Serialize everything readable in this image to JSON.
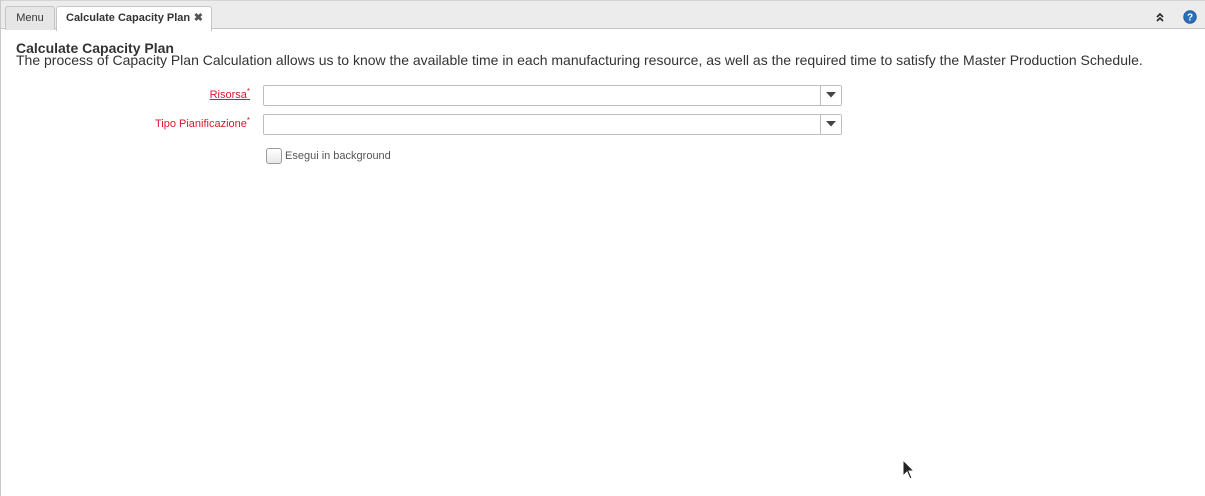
{
  "tabs": [
    {
      "label": "Menu",
      "active": false
    },
    {
      "label": "Calculate Capacity Plan",
      "active": true,
      "closable": true
    }
  ],
  "tabbar_icons": {
    "collapse": "double-chevron-up-icon",
    "help": "help-circle-icon"
  },
  "process": {
    "title": "Calculate Capacity Plan",
    "description": "The process of Capacity Plan Calculation allows us to know the available time in each manufacturing resource, as well as the required time to satisfy the Master Production Schedule."
  },
  "fields": {
    "risorsa": {
      "label": "Risorsa",
      "required_mark": "*",
      "value": ""
    },
    "tipo_pianificazione": {
      "label": "Tipo Pianificazione",
      "required_mark": "*",
      "value": ""
    }
  },
  "background_option": {
    "label": "Esegui in background",
    "checked": false
  },
  "colors": {
    "required_label": "#d8182a",
    "help_icon": "#2a6fb8",
    "tab_bar": "#ececec"
  }
}
